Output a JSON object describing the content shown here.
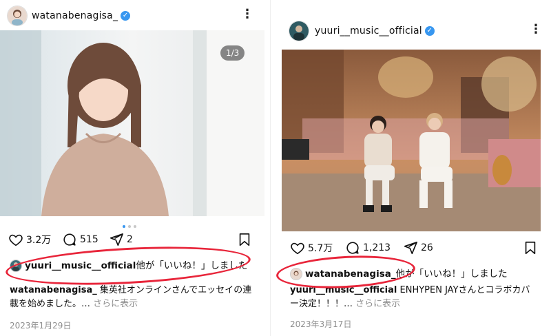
{
  "left_post": {
    "username": "watanabenagisa_",
    "counter": "1/3",
    "likes": "3.2万",
    "comments": "515",
    "shares": "2",
    "liked_by_user": "yuuri__music__official",
    "liked_by_suffix": "他が「いいね！」しました",
    "caption_user": "watanabenagisa_",
    "caption_text": "集英社オンラインさんでエッセイの連載を始めました。…",
    "caption_more": "さらに表示",
    "date": "2023年1月29日"
  },
  "right_post": {
    "username": "yuuri__music__official",
    "likes": "5.7万",
    "comments": "1,213",
    "shares": "26",
    "liked_by_user": "watanabenagisa_",
    "liked_by_suffix": "他が「いいね！」しました",
    "caption_user": "yuuri__music__official",
    "caption_text": "ENHYPEN JAYさんとコラボカバー決定！！！…",
    "caption_more": "さらに表示",
    "date": "2023年3月17日"
  },
  "colors": {
    "verified": "#3897f0",
    "annotation_circle": "#e8253a",
    "meta_gray": "#8e8e8e"
  },
  "icons": [
    "heart-icon",
    "comment-icon",
    "share-icon",
    "bookmark-icon",
    "more-icon",
    "verified-icon"
  ]
}
